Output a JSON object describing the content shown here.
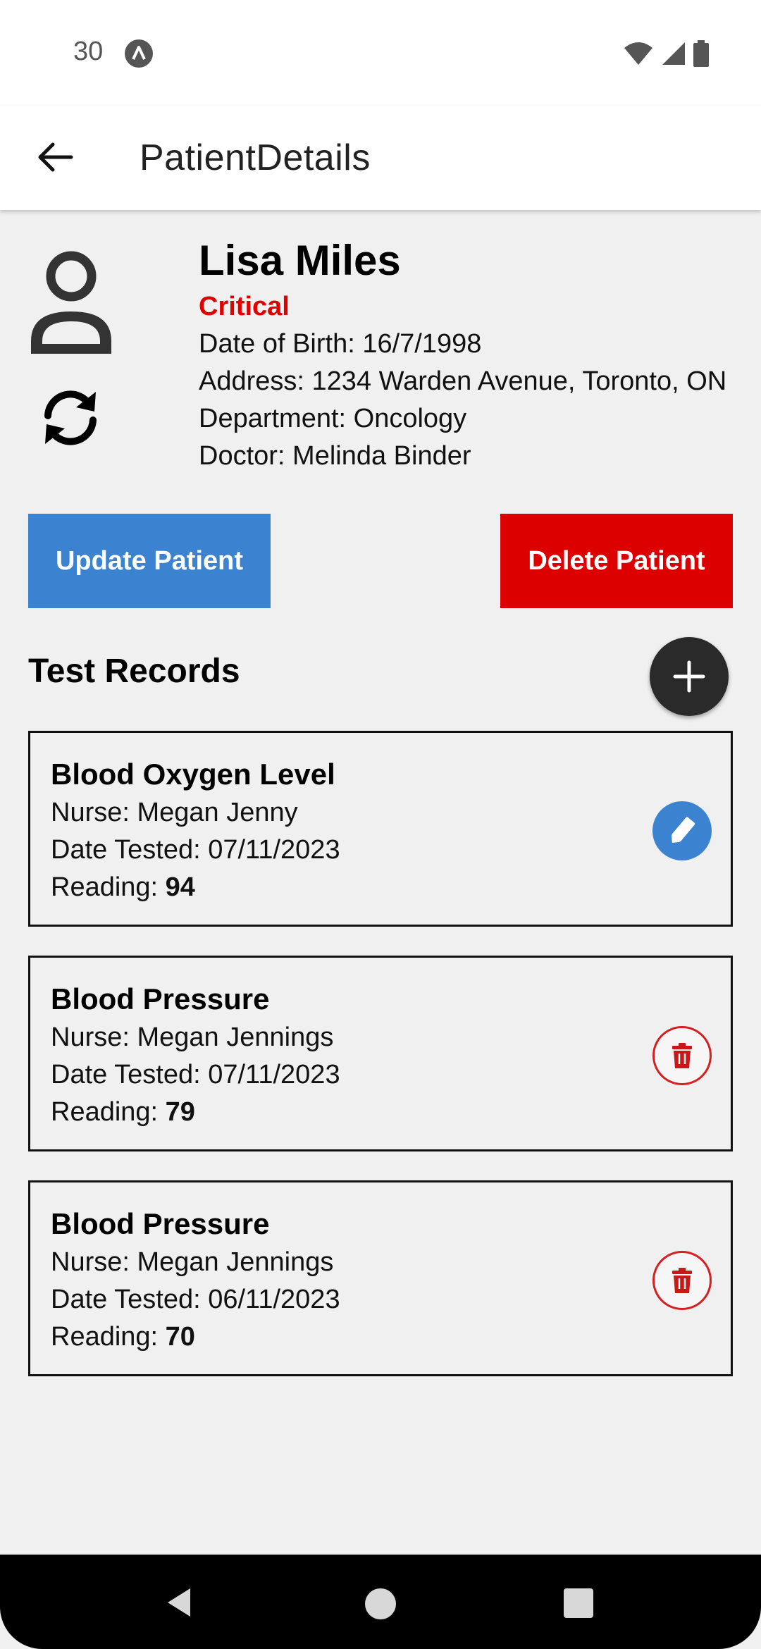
{
  "status_bar": {
    "time": "30",
    "icons": [
      "app-notification-icon",
      "wifi-icon",
      "signal-icon",
      "battery-icon"
    ]
  },
  "app_bar": {
    "title": "PatientDetails",
    "back_icon": "arrow-left-icon"
  },
  "patient": {
    "name": "Lisa Miles",
    "status": "Critical",
    "dob": "Date of Birth: 16/7/1998",
    "address": "Address: 1234 Warden Avenue, Toronto, ON",
    "department": "Department: Oncology",
    "doctor": "Doctor: Melinda Binder"
  },
  "actions": {
    "update_label": "Update Patient",
    "delete_label": "Delete Patient"
  },
  "test_records": {
    "title": "Test Records",
    "reading_label": "Reading: ",
    "items": [
      {
        "title": "Blood Oxygen Level",
        "nurse": "Nurse: Megan Jenny",
        "date": "Date Tested: 07/11/2023",
        "reading": "94",
        "action": "edit"
      },
      {
        "title": "Blood Pressure",
        "nurse": "Nurse: Megan Jennings",
        "date": "Date Tested: 07/11/2023",
        "reading": "79",
        "action": "delete"
      },
      {
        "title": "Blood Pressure",
        "nurse": "Nurse: Megan Jennings",
        "date": "Date Tested: 06/11/2023",
        "reading": "70",
        "action": "delete"
      }
    ]
  },
  "colors": {
    "update": "#3b82d0",
    "delete": "#dd0000",
    "critical": "#e00000",
    "fab": "#2a2a2a"
  }
}
